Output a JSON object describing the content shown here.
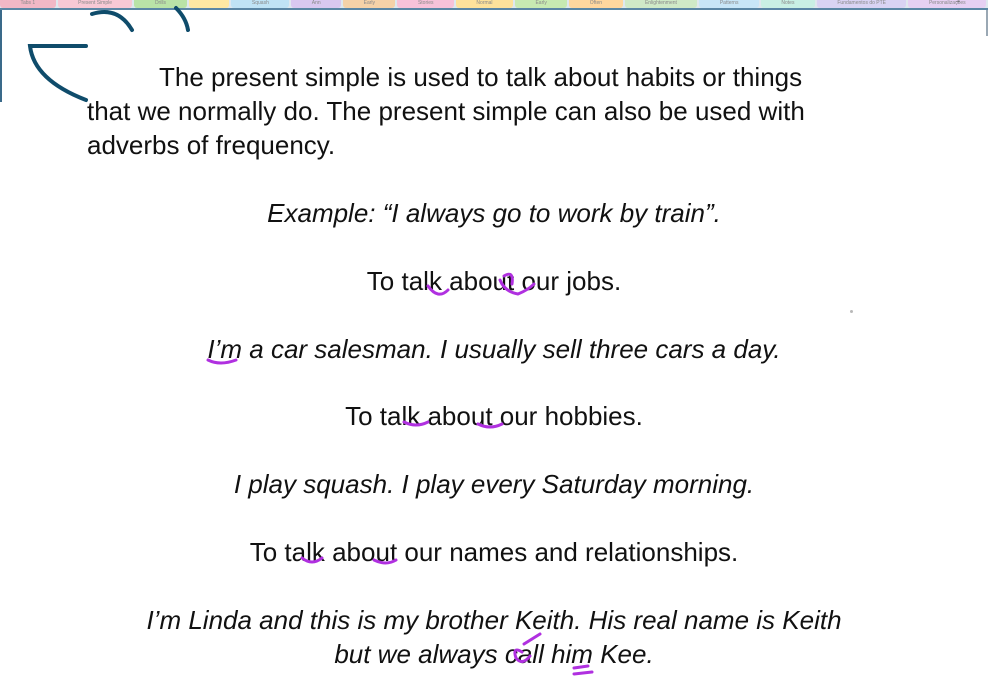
{
  "tabs": [
    {
      "label": "Tabs 1",
      "color": "#f2b8c6"
    },
    {
      "label": "Present Simple",
      "color": "#f7c9d5"
    },
    {
      "label": "Drills",
      "color": "#b9e3a7"
    },
    {
      "label": "",
      "color": "#ffe8a3"
    },
    {
      "label": "Squash",
      "color": "#bfe3f5"
    },
    {
      "label": "Ann",
      "color": "#d9c8f0"
    },
    {
      "label": "Early",
      "color": "#f5d2a8"
    },
    {
      "label": "Stories",
      "color": "#f7c2d9"
    },
    {
      "label": "Normal",
      "color": "#fde29b"
    },
    {
      "label": "Early",
      "color": "#c7eab2"
    },
    {
      "label": "Often",
      "color": "#ffd79e"
    },
    {
      "label": "Enlightenment",
      "color": "#cfe9c7"
    },
    {
      "label": "Patterns",
      "color": "#c8e6f7"
    },
    {
      "label": "Notes",
      "color": "#c9f0e4"
    },
    {
      "label": "Fundamentos do PTE",
      "color": "#d9d3f3"
    },
    {
      "label": "Personalizações",
      "color": "#e6d0f2"
    }
  ],
  "tab_add_label": "+",
  "text": {
    "para_line1": "The present simple is used to talk about habits or things",
    "para_line2": "that we normally do. The present simple can also be used with",
    "para_line3": "adverbs of frequency.",
    "example1": "Example: “I always go to work by train”.",
    "heading_jobs": "To talk about our jobs.",
    "example_jobs": "I’m a car salesman. I usually sell three cars a day.",
    "heading_hobbies": "To talk about our hobbies.",
    "example_hobbies": "I play squash.  I play every Saturday morning.",
    "heading_names": "To talk about our names and relationships.",
    "example_names_line1": "I’m Linda and this is my brother Keith. His real name is Keith",
    "example_names_line2": "but we always call him Kee."
  },
  "colors": {
    "ink_annotation": "#b030e0",
    "ink_corner": "#0f4c6b",
    "accent_line": "#5b87a5",
    "text": "#111111"
  }
}
